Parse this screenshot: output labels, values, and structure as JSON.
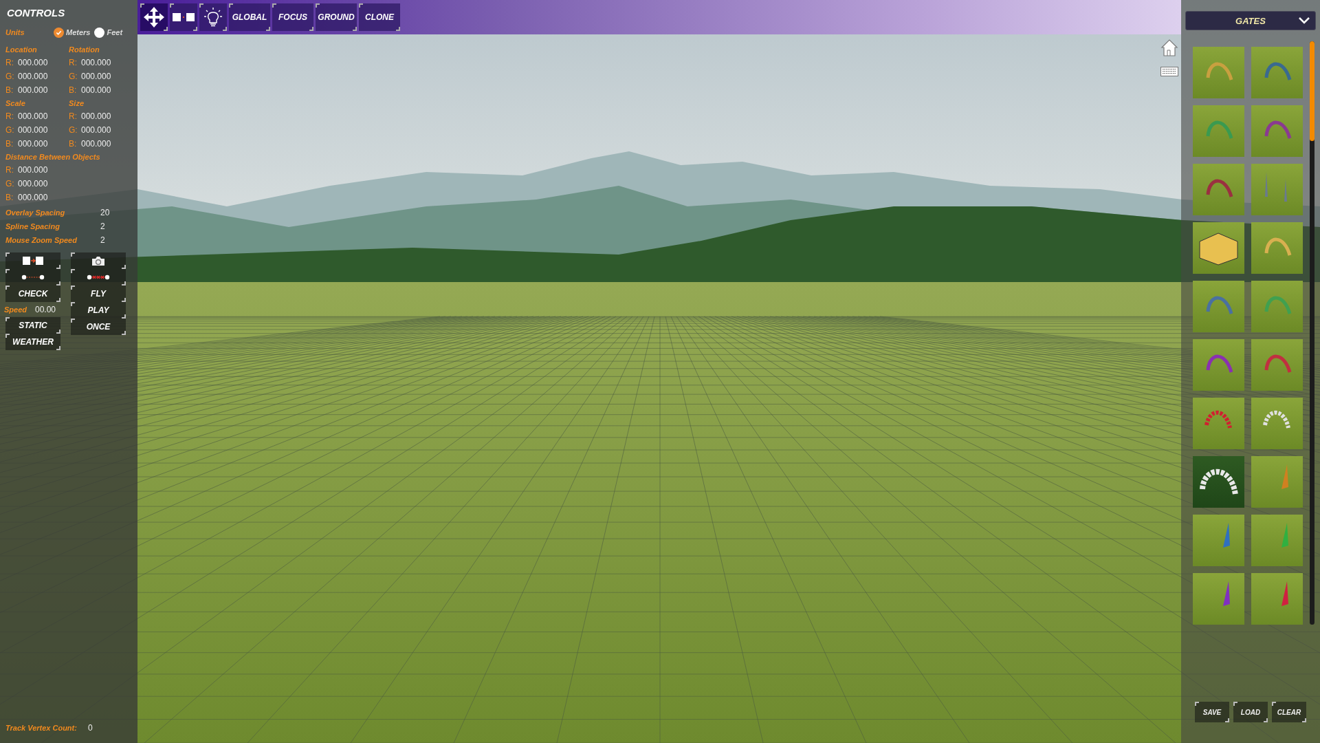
{
  "panel_title": "CONTROLS",
  "units": {
    "label": "Units",
    "options": [
      {
        "label": "Meters",
        "selected": true
      },
      {
        "label": "Feet",
        "selected": false
      }
    ]
  },
  "vector_groups": [
    {
      "label": "Location",
      "rows": [
        {
          "axis": "R:",
          "value": "000.000"
        },
        {
          "axis": "G:",
          "value": "000.000"
        },
        {
          "axis": "B:",
          "value": "000.000"
        }
      ]
    },
    {
      "label": "Rotation",
      "rows": [
        {
          "axis": "R:",
          "value": "000.000"
        },
        {
          "axis": "G:",
          "value": "000.000"
        },
        {
          "axis": "B:",
          "value": "000.000"
        }
      ]
    },
    {
      "label": "Scale",
      "rows": [
        {
          "axis": "R:",
          "value": "000.000"
        },
        {
          "axis": "G:",
          "value": "000.000"
        },
        {
          "axis": "B:",
          "value": "000.000"
        }
      ]
    },
    {
      "label": "Size",
      "rows": [
        {
          "axis": "R:",
          "value": "000.000"
        },
        {
          "axis": "G:",
          "value": "000.000"
        },
        {
          "axis": "B:",
          "value": "000.000"
        }
      ]
    },
    {
      "label": "Distance Between Objects",
      "rows": [
        {
          "axis": "R:",
          "value": "000.000"
        },
        {
          "axis": "G:",
          "value": "000.000"
        },
        {
          "axis": "B:",
          "value": "000.000"
        }
      ]
    }
  ],
  "settings": [
    {
      "label": "Overlay Spacing",
      "value": "20"
    },
    {
      "label": "Spline Spacing",
      "value": "2"
    },
    {
      "label": "Mouse Zoom Speed",
      "value": "2"
    }
  ],
  "left_column": {
    "check_button": "CHECK",
    "speed_label": "Speed",
    "speed_value": "00.00",
    "buttons": [
      "STATIC",
      "WEATHER"
    ]
  },
  "right_column": {
    "buttons": [
      "FLY",
      "PLAY",
      "ONCE"
    ]
  },
  "track_vertex_count": {
    "label": "Track Vertex Count:",
    "value": "0"
  },
  "toolbar": {
    "buttons": [
      "GLOBAL",
      "FOCUS",
      "GROUND",
      "CLONE"
    ]
  },
  "gates_dropdown": {
    "value": "GATES"
  },
  "gates": [
    {
      "kind": "arch",
      "color": "#c8a040"
    },
    {
      "kind": "arch",
      "color": "#3a6a90"
    },
    {
      "kind": "arch",
      "color": "#3a9a50"
    },
    {
      "kind": "arch",
      "color": "#8a3a90"
    },
    {
      "kind": "arch",
      "color": "#9a3040"
    },
    {
      "kind": "poles",
      "color": "#6a7a90"
    },
    {
      "kind": "tent",
      "color": "#e8c050"
    },
    {
      "kind": "arch",
      "color": "#d8b050"
    },
    {
      "kind": "arch",
      "color": "#4a70a0"
    },
    {
      "kind": "arch",
      "color": "#40a050"
    },
    {
      "kind": "arch",
      "color": "#8a30b0"
    },
    {
      "kind": "arch",
      "color": "#c03040"
    },
    {
      "kind": "striped-arch",
      "color": "#d02030"
    },
    {
      "kind": "striped-arch",
      "color": "#e0e0e0"
    },
    {
      "kind": "wide-arch",
      "color": "#e8e8e8"
    },
    {
      "kind": "flag",
      "color": "#d08020"
    },
    {
      "kind": "flag",
      "color": "#3070c0"
    },
    {
      "kind": "flag",
      "color": "#30b040"
    },
    {
      "kind": "flag",
      "color": "#8030c0"
    },
    {
      "kind": "flag",
      "color": "#d02040"
    }
  ],
  "file_buttons": [
    "SAVE",
    "LOAD",
    "CLEAR"
  ]
}
